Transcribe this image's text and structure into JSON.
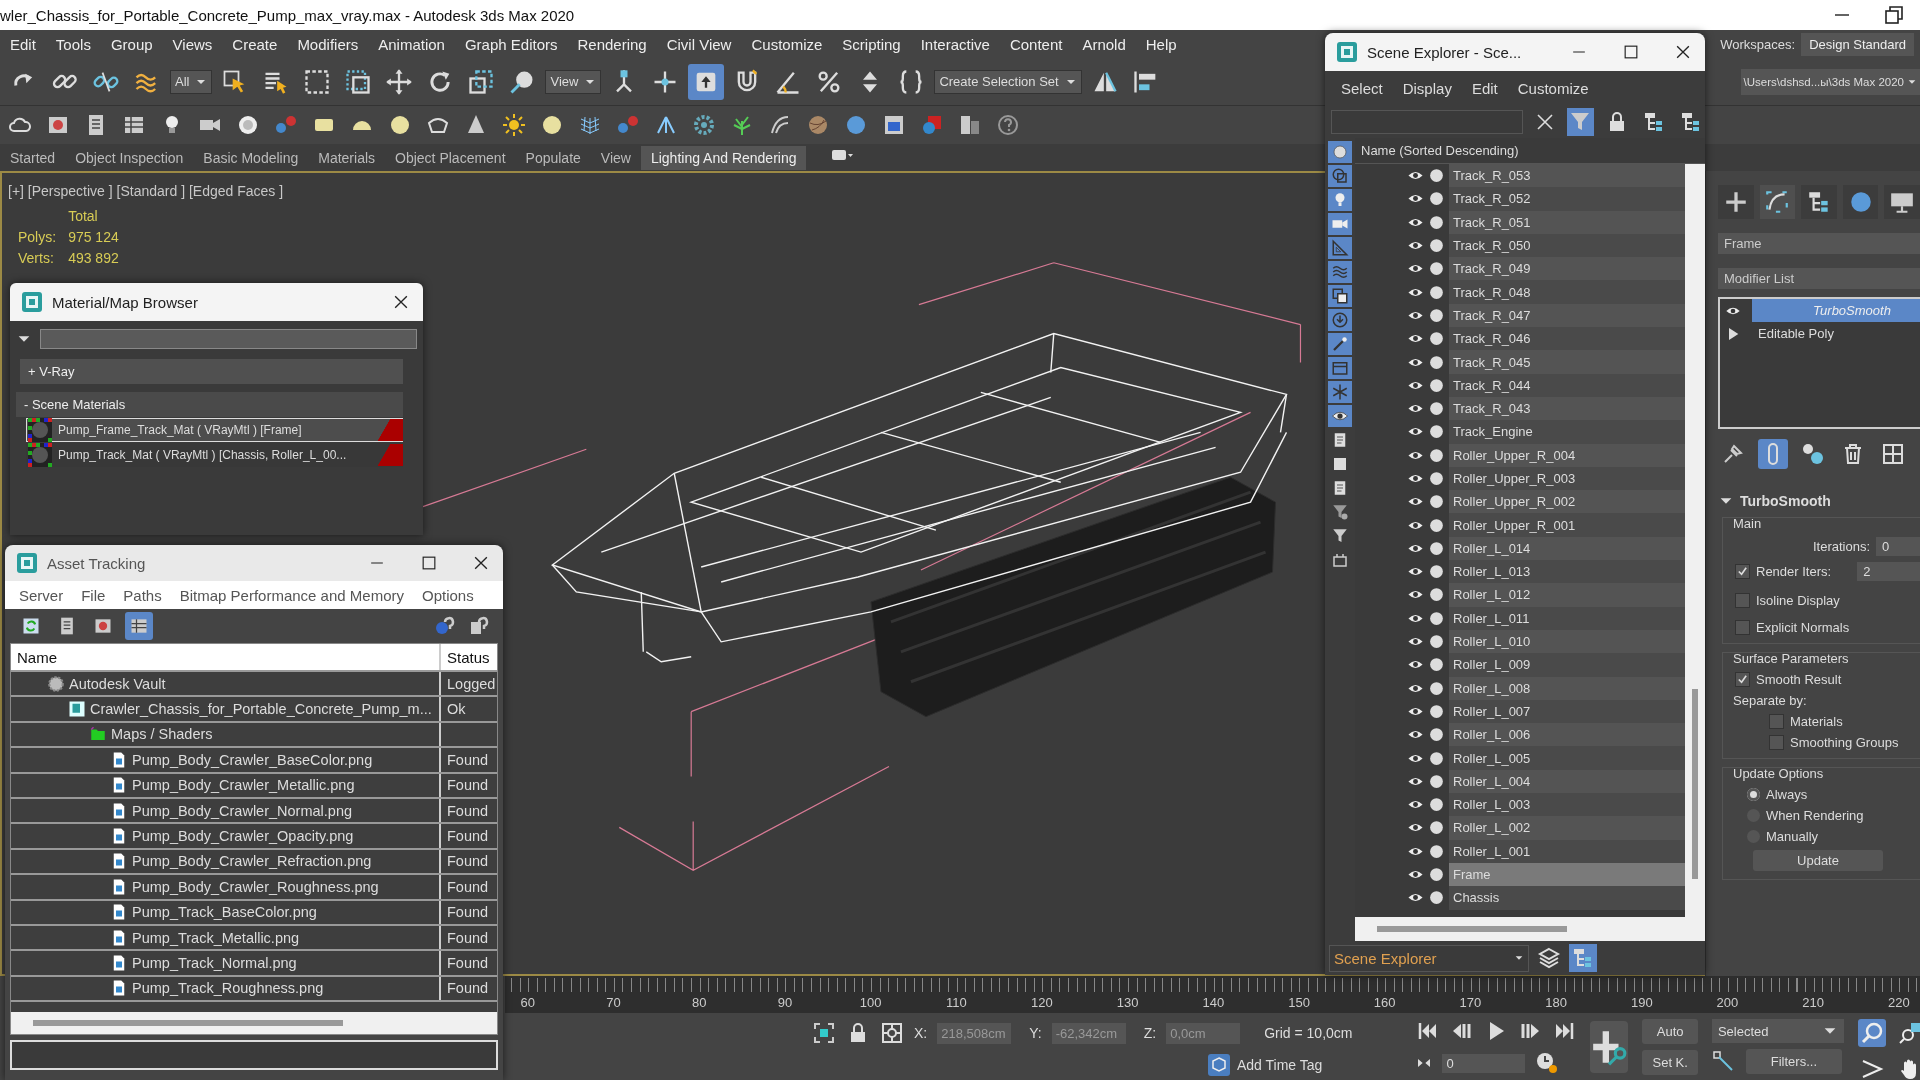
{
  "window": {
    "title": "wler_Chassis_for_Portable_Concrete_Pump_max_vray.max - Autodesk 3ds Max 2020"
  },
  "menu_bar": {
    "items": [
      "Edit",
      "Tools",
      "Group",
      "Views",
      "Create",
      "Modifiers",
      "Animation",
      "Graph Editors",
      "Rendering",
      "Civil View",
      "Customize",
      "Scripting",
      "Interactive",
      "Content",
      "Arnold",
      "Help"
    ],
    "workspaces_label": "Workspaces:",
    "workspace": "Design Standard"
  },
  "main_toolbar": {
    "items": [
      {
        "kind": "button",
        "selected": false
      },
      {
        "kind": "button",
        "selected": false
      },
      {
        "kind": "button",
        "selected": false
      },
      {
        "kind": "button",
        "selected": false
      },
      {
        "kind": "dropdown",
        "value": "All"
      },
      {
        "kind": "button",
        "selected": false
      },
      {
        "kind": "button",
        "selected": false
      },
      {
        "kind": "button",
        "selected": false
      },
      {
        "kind": "button",
        "selected": false
      },
      {
        "kind": "button",
        "selected": false
      },
      {
        "kind": "button",
        "selected": false
      },
      {
        "kind": "button",
        "selected": false
      },
      {
        "kind": "button",
        "selected": false
      },
      {
        "kind": "dropdown",
        "value": "View"
      },
      {
        "kind": "button",
        "selected": false
      },
      {
        "kind": "button",
        "selected": false
      },
      {
        "kind": "button",
        "selected": true
      },
      {
        "kind": "button",
        "selected": false
      },
      {
        "kind": "button",
        "selected": false
      },
      {
        "kind": "button",
        "selected": false
      },
      {
        "kind": "button",
        "selected": false
      },
      {
        "kind": "button",
        "selected": false
      },
      {
        "kind": "dropdown",
        "value": "Create Selection Set"
      },
      {
        "kind": "button",
        "selected": false
      },
      {
        "kind": "button",
        "selected": false
      }
    ],
    "project_path": "\\Users\\dshsd...ы\\3ds Max 2020"
  },
  "ribbon": {
    "tabs": [
      {
        "label": "Started",
        "selected": false
      },
      {
        "label": "Object Inspection",
        "selected": false
      },
      {
        "label": "Basic Modeling",
        "selected": false
      },
      {
        "label": "Materials",
        "selected": false
      },
      {
        "label": "Object Placement",
        "selected": false
      },
      {
        "label": "Populate",
        "selected": false
      },
      {
        "label": "View",
        "selected": false
      },
      {
        "label": "Lighting And Rendering",
        "selected": true
      }
    ]
  },
  "viewport": {
    "label": "[+] [Perspective ] [Standard ] [Edged Faces ]",
    "stats_header": "Total",
    "stats": [
      {
        "label": "Polys:",
        "value": "975 124"
      },
      {
        "label": "Verts:",
        "value": "493 892"
      }
    ]
  },
  "material_browser": {
    "title": "Material/Map Browser",
    "vray_group": "+ V-Ray",
    "scene_group": "- Scene Materials",
    "materials": [
      {
        "name": "Pump_Frame_Track_Mat  ( VRayMtl )  [Frame]",
        "selected": true
      },
      {
        "name": "Pump_Track_Mat  ( VRayMtl )  [Chassis, Roller_L_00...",
        "selected": false
      }
    ]
  },
  "asset_tracking": {
    "title": "Asset Tracking",
    "menu": [
      "Server",
      "File",
      "Paths",
      "Bitmap Performance and Memory",
      "Options"
    ],
    "toolbar": [
      {
        "selected": false
      },
      {
        "selected": false
      },
      {
        "selected": false
      },
      {
        "selected": true
      }
    ],
    "columns": [
      "Name",
      "Status"
    ],
    "rows": [
      {
        "kind": "vault",
        "name": "Autodesk Vault",
        "status": "Logged",
        "children": [
          {
            "kind": "scene",
            "name": "Crawler_Chassis_for_Portable_Concrete_Pump_m...",
            "status": "Ok",
            "children": [
              {
                "kind": "folder",
                "name": "Maps / Shaders",
                "children": [
                  {
                    "kind": "image",
                    "name": "Pump_Body_Crawler_BaseColor.png",
                    "status": "Found"
                  },
                  {
                    "kind": "image",
                    "name": "Pump_Body_Crawler_Metallic.png",
                    "status": "Found"
                  },
                  {
                    "kind": "image",
                    "name": "Pump_Body_Crawler_Normal.png",
                    "status": "Found"
                  },
                  {
                    "kind": "image",
                    "name": "Pump_Body_Crawler_Opacity.png",
                    "status": "Found"
                  },
                  {
                    "kind": "image",
                    "name": "Pump_Body_Crawler_Refraction.png",
                    "status": "Found"
                  },
                  {
                    "kind": "image",
                    "name": "Pump_Body_Crawler_Roughness.png",
                    "status": "Found"
                  },
                  {
                    "kind": "image",
                    "name": "Pump_Track_BaseColor.png",
                    "status": "Found"
                  },
                  {
                    "kind": "image",
                    "name": "Pump_Track_Metallic.png",
                    "status": "Found"
                  },
                  {
                    "kind": "image",
                    "name": "Pump_Track_Normal.png",
                    "status": "Found"
                  },
                  {
                    "kind": "image",
                    "name": "Pump_Track_Roughness.png",
                    "status": "Found"
                  }
                ]
              }
            ]
          }
        ]
      }
    ]
  },
  "scene_explorer": {
    "title": "Scene Explorer - Sce...",
    "menu": [
      "Select",
      "Display",
      "Edit",
      "Customize"
    ],
    "toolbar": [
      {
        "selected": true
      },
      {
        "selected": false
      },
      {
        "selected": false
      },
      {
        "selected": false
      }
    ],
    "column": "Name (Sorted Descending)",
    "side_toolbar": [
      {
        "selected": true
      },
      {
        "selected": true
      },
      {
        "selected": true
      },
      {
        "selected": true
      },
      {
        "selected": true
      },
      {
        "selected": true
      },
      {
        "selected": true
      },
      {
        "selected": true
      },
      {
        "selected": true
      },
      {
        "selected": true
      },
      {
        "selected": true
      },
      {
        "selected": true
      },
      {
        "selected": false
      },
      {
        "selected": false
      },
      {
        "selected": false
      },
      {
        "selected": false
      },
      {
        "selected": false
      },
      {
        "selected": false
      }
    ],
    "objects": [
      {
        "name": "Track_R_053",
        "selected": false
      },
      {
        "name": "Track_R_052",
        "selected": false
      },
      {
        "name": "Track_R_051",
        "selected": false
      },
      {
        "name": "Track_R_050",
        "selected": false
      },
      {
        "name": "Track_R_049",
        "selected": false
      },
      {
        "name": "Track_R_048",
        "selected": false
      },
      {
        "name": "Track_R_047",
        "selected": false
      },
      {
        "name": "Track_R_046",
        "selected": false
      },
      {
        "name": "Track_R_045",
        "selected": false
      },
      {
        "name": "Track_R_044",
        "selected": false
      },
      {
        "name": "Track_R_043",
        "selected": false
      },
      {
        "name": "Track_Engine",
        "selected": false
      },
      {
        "name": "Roller_Upper_R_004",
        "selected": false
      },
      {
        "name": "Roller_Upper_R_003",
        "selected": false
      },
      {
        "name": "Roller_Upper_R_002",
        "selected": false
      },
      {
        "name": "Roller_Upper_R_001",
        "selected": false
      },
      {
        "name": "Roller_L_014",
        "selected": false
      },
      {
        "name": "Roller_L_013",
        "selected": false
      },
      {
        "name": "Roller_L_012",
        "selected": false
      },
      {
        "name": "Roller_L_011",
        "selected": false
      },
      {
        "name": "Roller_L_010",
        "selected": false
      },
      {
        "name": "Roller_L_009",
        "selected": false
      },
      {
        "name": "Roller_L_008",
        "selected": false
      },
      {
        "name": "Roller_L_007",
        "selected": false
      },
      {
        "name": "Roller_L_006",
        "selected": false
      },
      {
        "name": "Roller_L_005",
        "selected": false
      },
      {
        "name": "Roller_L_004",
        "selected": false
      },
      {
        "name": "Roller_L_003",
        "selected": false
      },
      {
        "name": "Roller_L_002",
        "selected": false
      },
      {
        "name": "Roller_L_001",
        "selected": false
      },
      {
        "name": "Frame",
        "selected": true
      },
      {
        "name": "Chassis",
        "selected": false
      }
    ],
    "footer": "Scene Explorer",
    "footer_tools": [
      {
        "selected": false
      },
      {
        "selected": true
      }
    ]
  },
  "command_panel": {
    "tabs": [
      {
        "selected": false
      },
      {
        "selected": true
      },
      {
        "selected": false
      },
      {
        "selected": false
      },
      {
        "selected": false
      }
    ],
    "object_name": "Frame",
    "modifier_list": "Modifier List",
    "stack": [
      {
        "kind": "modifier",
        "name": "TurboSmooth",
        "selected": true
      },
      {
        "kind": "base",
        "name": "Editable Poly",
        "selected": false
      }
    ],
    "stack_tools": [
      {
        "selected": false
      },
      {
        "selected": true
      },
      {
        "selected": false
      },
      {
        "selected": false
      },
      {
        "selected": false
      }
    ],
    "rollout": {
      "title": "TurboSmooth",
      "main_title": "Main",
      "iterations_label": "Iterations:",
      "iterations": "0",
      "render_iters_label": "Render Iters:",
      "render_iters_checked": true,
      "render_iters": "2",
      "main_options": [
        {
          "label": "Isoline Display",
          "checked": false
        },
        {
          "label": "Explicit Normals",
          "checked": false
        }
      ],
      "surface_title": "Surface Parameters",
      "smooth_result": {
        "label": "Smooth Result",
        "checked": true
      },
      "separate_by": "Separate by:",
      "separate_options": [
        {
          "label": "Materials",
          "checked": false
        },
        {
          "label": "Smoothing Groups",
          "checked": false
        }
      ],
      "update_title": "Update Options",
      "update_options": [
        {
          "label": "Always",
          "selected": true
        },
        {
          "label": "When Rendering",
          "selected": false
        },
        {
          "label": "Manually",
          "selected": false
        }
      ],
      "update_button": "Update"
    }
  },
  "timeline": {
    "ticks": [
      "60",
      "70",
      "80",
      "90",
      "100",
      "110",
      "120",
      "130",
      "140",
      "150",
      "160",
      "170",
      "180",
      "190",
      "200",
      "210",
      "220"
    ]
  },
  "status_bar": {
    "x_label": "X:",
    "x": "218,508cm",
    "y_label": "Y:",
    "y": "-62,342cm",
    "z_label": "Z:",
    "z": "0,0cm",
    "grid": "Grid = 10,0cm",
    "add_time_tag": "Add Time Tag",
    "frame": "0",
    "auto_key": "Auto",
    "set_key": "Set K.",
    "key_filter": "Selected",
    "filters": "Filters...",
    "nav_tools": [
      {
        "selected": true
      },
      {
        "selected": false
      },
      {
        "selected": false
      },
      {
        "selected": false
      }
    ]
  }
}
